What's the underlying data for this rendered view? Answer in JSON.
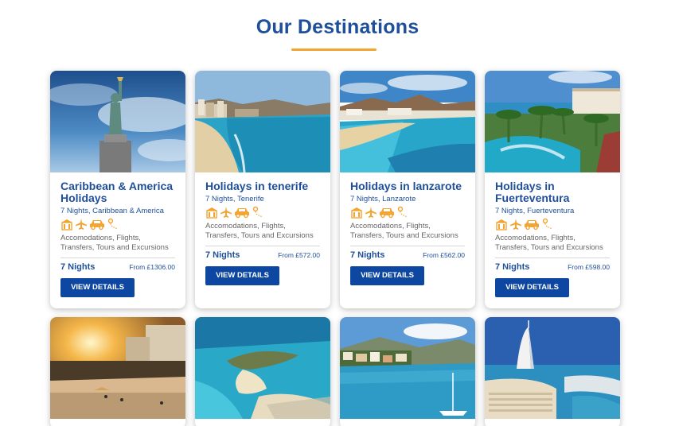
{
  "heading": "Our Destinations",
  "colors": {
    "heading": "#1f4f9a",
    "accent_underline": "#f2a531",
    "button": "#0d47a1",
    "icon": "#f2a531"
  },
  "feature_icons": [
    "hotel-icon",
    "flight-icon",
    "car-icon",
    "tour-map-icon"
  ],
  "cards": [
    {
      "title": "Caribbean & America Holidays",
      "subtitle": "7 Nights, Caribbean & America",
      "features": "Accomodations, Flights, Transfers, Tours and Excursions",
      "nights": "7 Nights",
      "price": "From £1306.00",
      "button": "VIEW DETAILS",
      "image": "statue-of-liberty-image"
    },
    {
      "title": "Holidays in tenerife",
      "subtitle": "7 Nights, Tenerife",
      "features": "Accomodations, Flights, Transfers, Tours and Excursions",
      "nights": "7 Nights",
      "price": "From £572.00",
      "button": "VIEW DETAILS",
      "image": "tenerife-beach-image"
    },
    {
      "title": "Holidays in lanzarote",
      "subtitle": "7 Nights, Lanzarote",
      "features": "Accomodations, Flights, Transfers, Tours and Excursions",
      "nights": "7 Nights",
      "price": "From £562.00",
      "button": "VIEW DETAILS",
      "image": "lanzarote-beach-image"
    },
    {
      "title": "Holidays in Fuerteventura",
      "subtitle": "7 Nights, Fuerteventura",
      "features": "Accomodations, Flights, Transfers, Tours and Excursions",
      "nights": "7 Nights",
      "price": "From £598.00",
      "button": "VIEW DETAILS",
      "image": "fuerteventura-resort-image"
    }
  ],
  "cards_row2": [
    {
      "image": "sunset-beach-image"
    },
    {
      "image": "turquoise-island-image"
    },
    {
      "image": "harbour-village-image"
    },
    {
      "image": "dubai-burj-al-arab-image"
    }
  ]
}
